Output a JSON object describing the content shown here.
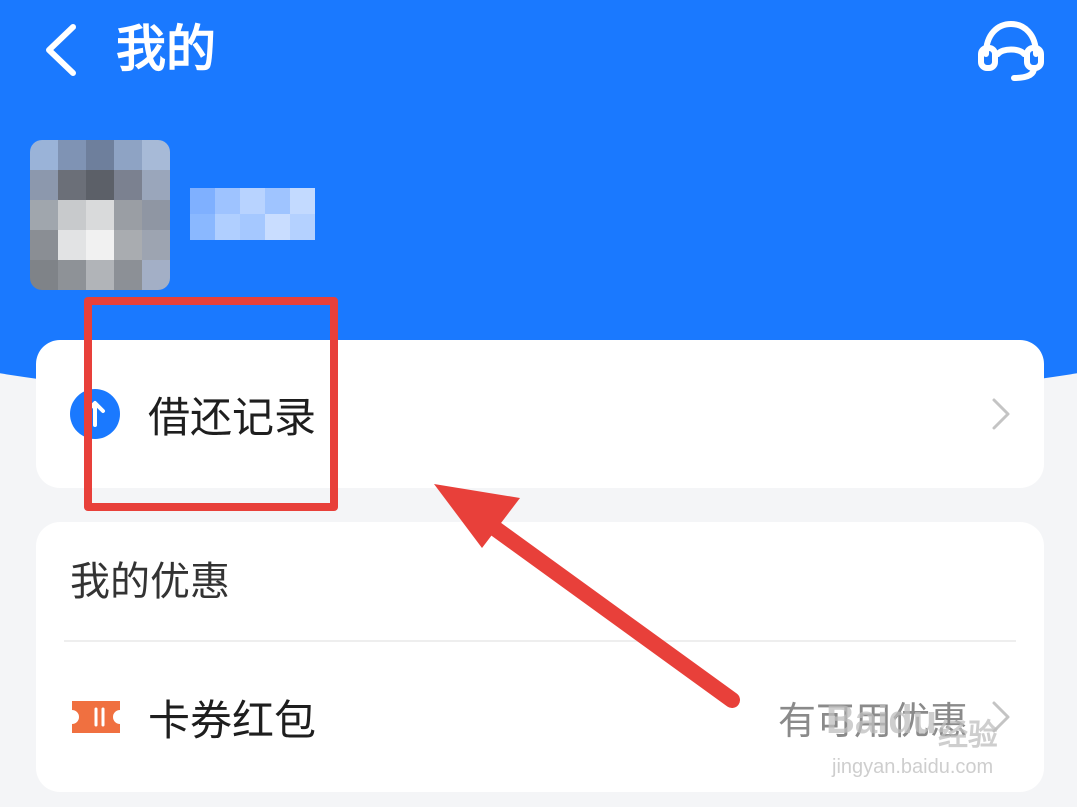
{
  "header": {
    "title": "我的",
    "bg_color": "#1a79ff"
  },
  "icons": {
    "back": "back-arrow-icon",
    "customer_service": "headset-icon",
    "borrow": "upload-arrow-icon",
    "coupon": "ticket-icon",
    "chevron": "chevron-right-icon"
  },
  "borrow_card": {
    "label": "借还记录"
  },
  "benefits": {
    "section_title": "我的优惠",
    "coupon_label": "卡券红包",
    "coupon_value": "有可用优惠"
  },
  "colors": {
    "accent": "#1a79ff",
    "coupon_orange": "#f07040",
    "annotation_red": "#e8403a"
  },
  "watermark": {
    "brand": "Baidu",
    "brand_cn": "经验",
    "url": "jingyan.baidu.com"
  }
}
